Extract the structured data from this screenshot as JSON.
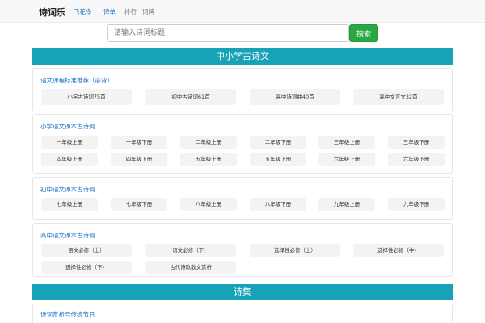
{
  "nav": {
    "brand": "诗词乐",
    "links": [
      "飞花令",
      "诗单",
      "排行",
      "词牌"
    ]
  },
  "search": {
    "placeholder": "请输入诗词标题",
    "button": "搜索"
  },
  "sections": {
    "school": "中小学古诗文",
    "collections": "诗集"
  },
  "cards": [
    {
      "title": "语文课程标准推荐（必背）",
      "items": [
        "小学古诗词75首",
        "初中古诗词61首",
        "高中诗词曲40首",
        "高中文言文32首"
      ]
    },
    {
      "title": "小学语文课本古诗词",
      "items": [
        "一年级上册",
        "一年级下册",
        "二年级上册",
        "二年级下册",
        "三年级上册",
        "三年级下册",
        "四年级上册",
        "四年级下册",
        "五年级上册",
        "五年级下册",
        "六年级上册",
        "六年级下册"
      ]
    },
    {
      "title": "初中语文课本古诗词",
      "items": [
        "七年级上册",
        "七年级下册",
        "八年级上册",
        "八年级下册",
        "九年级上册",
        "九年级下册"
      ]
    },
    {
      "title": "高中语文课本古诗词",
      "items": [
        "语文必修（上）",
        "语文必修（下）",
        "选择性必修（上）",
        "选择性必修（中）",
        "选择性必修（下）",
        "古代诗歌散文赏析"
      ]
    },
    {
      "title": "诗词赏析与传统节日",
      "items": []
    }
  ],
  "colors": {
    "accent_banner": "#17a2b8",
    "search_button": "#28a745",
    "link_blue": "#1a73c8",
    "chip_bg": "#f3f3f3"
  }
}
